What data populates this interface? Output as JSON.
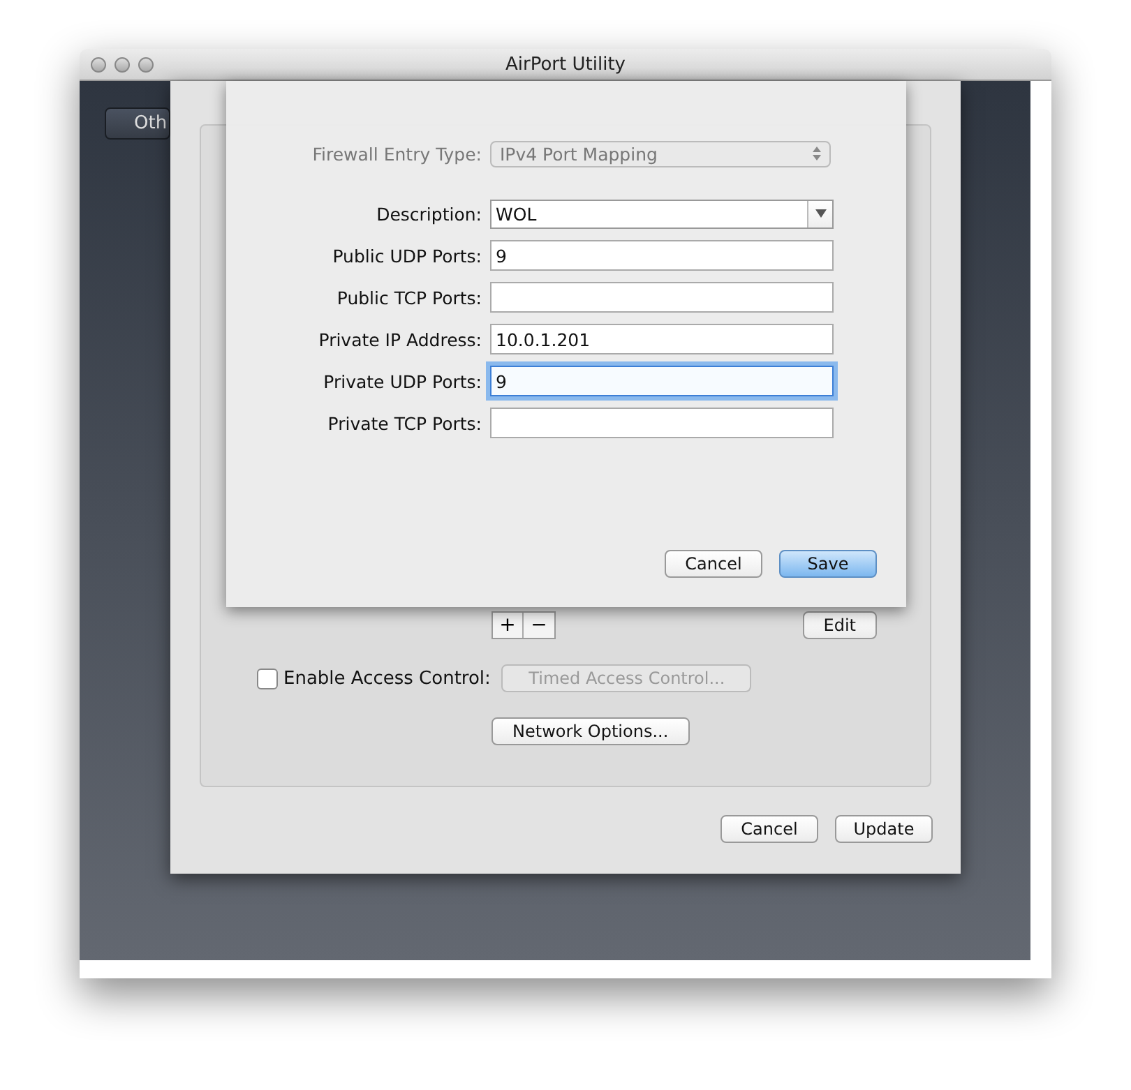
{
  "window": {
    "title": "AirPort Utility"
  },
  "sidebar": {
    "button": "Oth"
  },
  "settings_panel": {
    "add_button": "+",
    "remove_button": "−",
    "edit_button": "Edit",
    "access_control": {
      "label": "Enable Access Control:",
      "checked": false
    },
    "timed_access_button": {
      "label": "Timed Access Control...",
      "disabled": true
    },
    "network_options_button": "Network Options...",
    "buttons": [
      {
        "label": "Cancel",
        "default": false
      },
      {
        "label": "Update",
        "default": false
      }
    ]
  },
  "entry_sheet": {
    "fields": [
      {
        "kind": "popup",
        "label": "Firewall Entry Type:",
        "value": "IPv4 Port Mapping",
        "disabled": true
      },
      {
        "kind": "combo",
        "label": "Description:",
        "value": "WOL"
      },
      {
        "kind": "text",
        "label": "Public UDP Ports:",
        "value": "9",
        "focused": false
      },
      {
        "kind": "text",
        "label": "Public TCP Ports:",
        "focused": false
      },
      {
        "kind": "text",
        "label": "Private IP Address:",
        "value": "10.0.1.201",
        "focused": false
      },
      {
        "kind": "text",
        "label": "Private UDP Ports:",
        "value": "9",
        "focused": true
      },
      {
        "kind": "text",
        "label": "Private TCP Ports:",
        "focused": false
      }
    ],
    "buttons": [
      {
        "label": "Cancel",
        "default": false
      },
      {
        "label": "Save",
        "default": true
      }
    ]
  }
}
